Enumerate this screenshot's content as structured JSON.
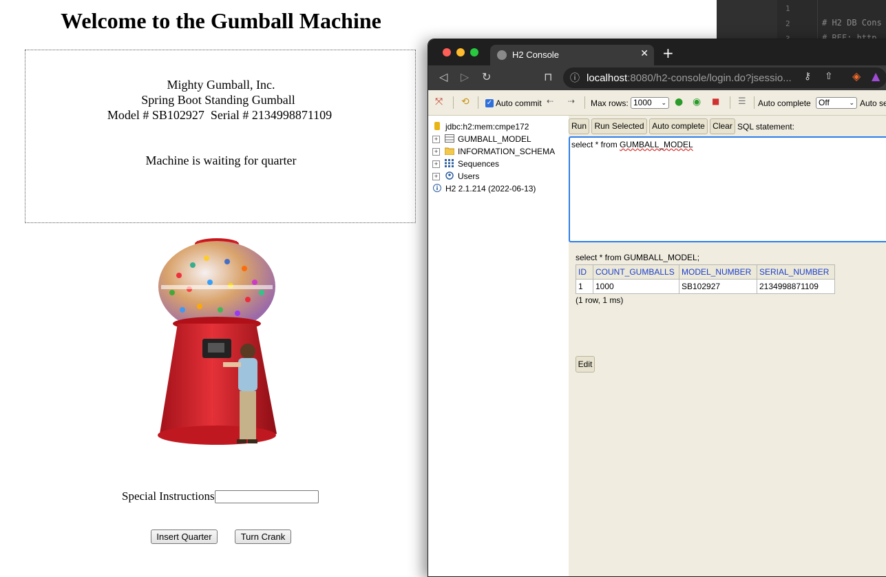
{
  "gumball_page": {
    "title": "Welcome to the Gumball Machine",
    "company": "Mighty Gumball, Inc.",
    "product": "Spring Boot Standing Gumball",
    "model_serial": "Model # SB102927  Serial # 2134998871109",
    "status": "Machine is waiting for quarter",
    "instructions_label": "Special Instructions:",
    "instructions_value": "",
    "insert_quarter_label": "Insert Quarter",
    "turn_crank_label": "Turn Crank"
  },
  "editor": {
    "line_numbers": [
      "1",
      "2",
      "3"
    ],
    "lines": [
      "",
      "# H2 DB Cons",
      "# REF: http"
    ]
  },
  "browser": {
    "tab_title": "H2 Console",
    "url_host": "localhost",
    "url_rest": ":8080/h2-console/login.do?jsessio..."
  },
  "h2_toolbar": {
    "auto_commit_label": "Auto commit",
    "auto_commit_checked": true,
    "max_rows_label": "Max rows:",
    "max_rows_value": "1000",
    "auto_complete_label": "Auto complete",
    "auto_complete_value": "Off",
    "auto_select_label": "Auto se"
  },
  "tree": {
    "connection": "jdbc:h2:mem:cmpe172",
    "items": [
      {
        "label": "GUMBALL_MODEL",
        "icon": "table-icon"
      },
      {
        "label": "INFORMATION_SCHEMA",
        "icon": "folder-icon"
      },
      {
        "label": "Sequences",
        "icon": "sequences-icon"
      },
      {
        "label": "Users",
        "icon": "users-icon"
      }
    ],
    "version": "H2 2.1.214 (2022-06-13)"
  },
  "sql_panel": {
    "run_label": "Run",
    "run_selected_label": "Run Selected",
    "auto_complete_label": "Auto complete",
    "clear_label": "Clear",
    "statement_label": "SQL statement:",
    "query_prefix": "select * from ",
    "query_table": "GUMBALL_MODEL",
    "result_statement": "select * from GUMBALL_MODEL;",
    "columns": [
      "ID",
      "COUNT_GUMBALLS",
      "MODEL_NUMBER",
      "SERIAL_NUMBER"
    ],
    "rows": [
      [
        "1",
        "1000",
        "SB102927",
        "2134998871109"
      ]
    ],
    "result_info": "(1 row, 1 ms)",
    "edit_label": "Edit"
  }
}
